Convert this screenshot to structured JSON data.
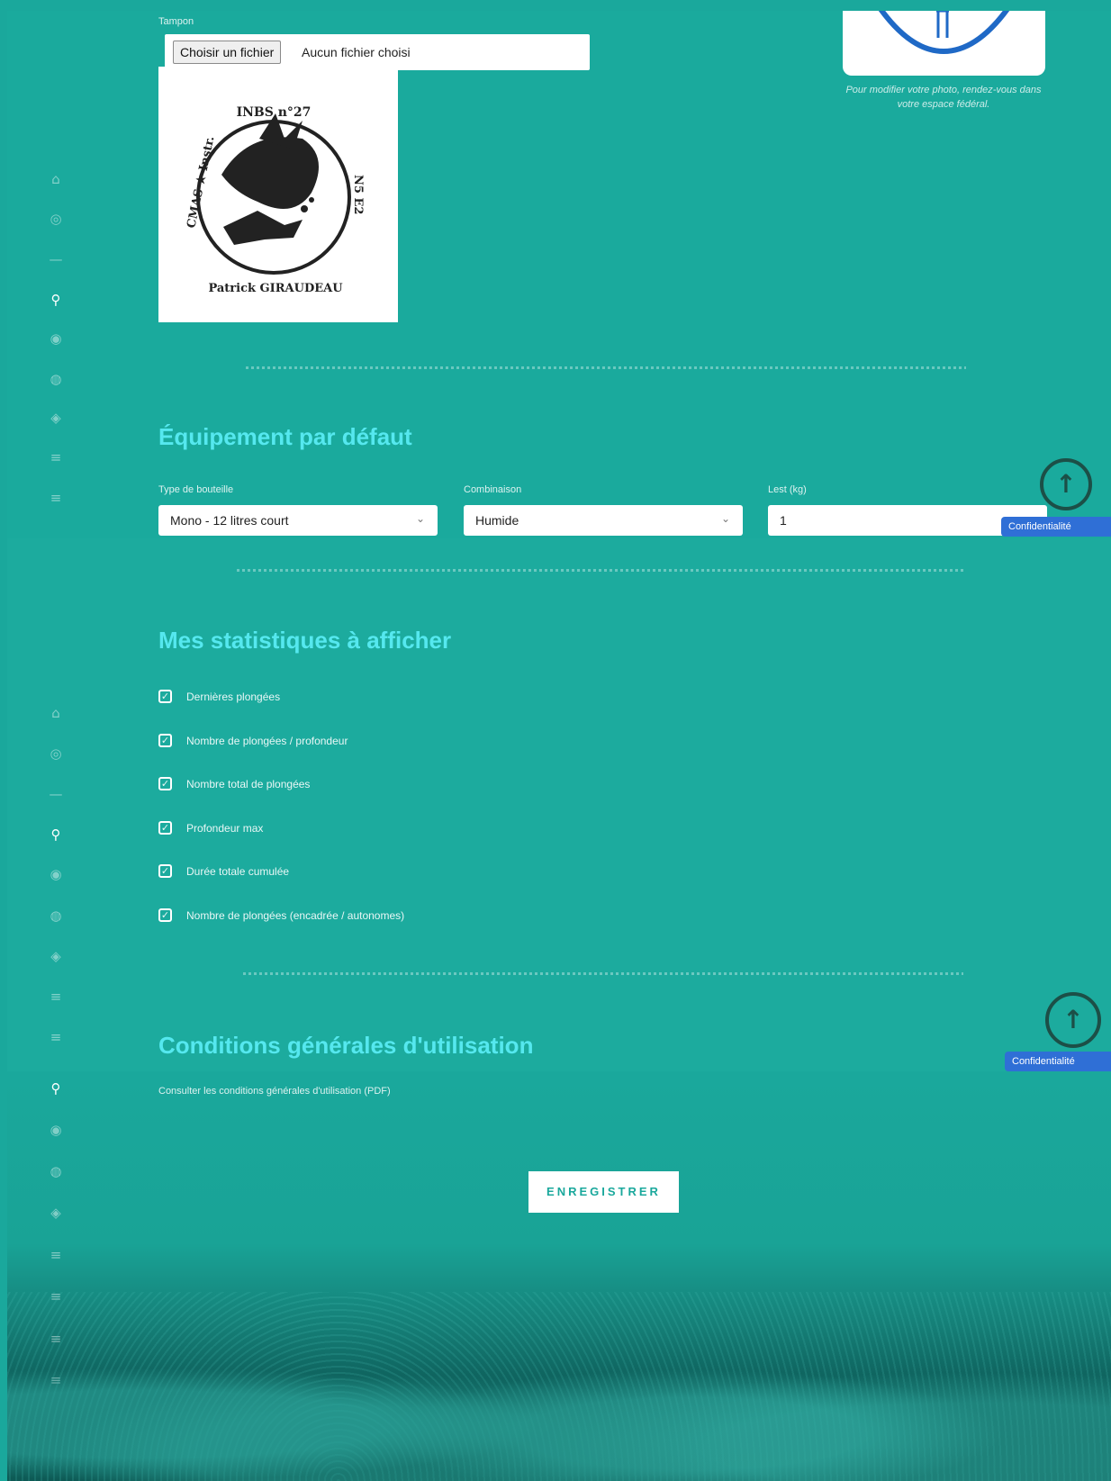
{
  "stamp_section": {
    "label": "Tampon",
    "file_button": "Choisir un fichier",
    "file_status": "Aucun fichier choisi",
    "stamp_text_top": "INBS n°27",
    "stamp_text_left": "CMAS ★ Instr.",
    "stamp_text_right": "N5 E2",
    "stamp_text_bottom": "Patrick GIRAUDEAU"
  },
  "photo": {
    "note": "Pour modifier votre photo, rendez-vous dans votre espace fédéral."
  },
  "equipment": {
    "title": "Équipement par défaut",
    "bottle_label": "Type de bouteille",
    "bottle_value": "Mono - 12 litres court",
    "suit_label": "Combinaison",
    "suit_value": "Humide",
    "weight_label": "Lest (kg)",
    "weight_value": "1"
  },
  "stats": {
    "title": "Mes statistiques à afficher",
    "items": [
      {
        "label": "Dernières plongées",
        "checked": true
      },
      {
        "label": "Nombre de plongées / profondeur",
        "checked": true
      },
      {
        "label": "Nombre total de plongées",
        "checked": true
      },
      {
        "label": "Profondeur max",
        "checked": true
      },
      {
        "label": "Durée totale cumulée",
        "checked": true
      },
      {
        "label": "Nombre de plongées (encadrée / autonomes)",
        "checked": true
      }
    ]
  },
  "terms": {
    "title": "Conditions générales d'utilisation",
    "link": "Consulter les conditions générales d'utilisation (PDF)"
  },
  "actions": {
    "save": "ENREGISTRER",
    "privacy": "Confidentialité"
  },
  "icons": {
    "scroll_top": "↑",
    "checkmark": "✓",
    "chevron": "⌄"
  },
  "colors": {
    "background": "#1aaa9d",
    "heading": "#55e8ef",
    "privacy_badge": "#2f6fd6"
  }
}
